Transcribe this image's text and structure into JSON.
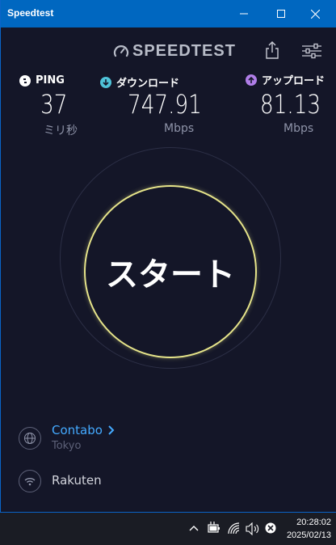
{
  "window": {
    "title": "Speedtest"
  },
  "header": {
    "logo_text": "SPEEDTEST"
  },
  "metrics": {
    "ping": {
      "label": "PING",
      "value": "37",
      "unit": "ミリ秒"
    },
    "download": {
      "label": "ダウンロード",
      "value": "747.91",
      "unit": "Mbps"
    },
    "upload": {
      "label": "アップロード",
      "value": "81.13",
      "unit": "Mbps"
    }
  },
  "start": {
    "label": "スタート"
  },
  "server": {
    "name": "Contabo",
    "city": "Tokyo"
  },
  "isp": {
    "name": "Rakuten"
  },
  "taskbar": {
    "time": "20:28:02",
    "date": "2025/02/13"
  },
  "colors": {
    "titlebar": "#0067c0",
    "background": "#141628",
    "start_ring": "#e6e48a",
    "server_link": "#44aaff",
    "download_accent": "#4fc3d9",
    "upload_accent": "#b07ee8"
  }
}
